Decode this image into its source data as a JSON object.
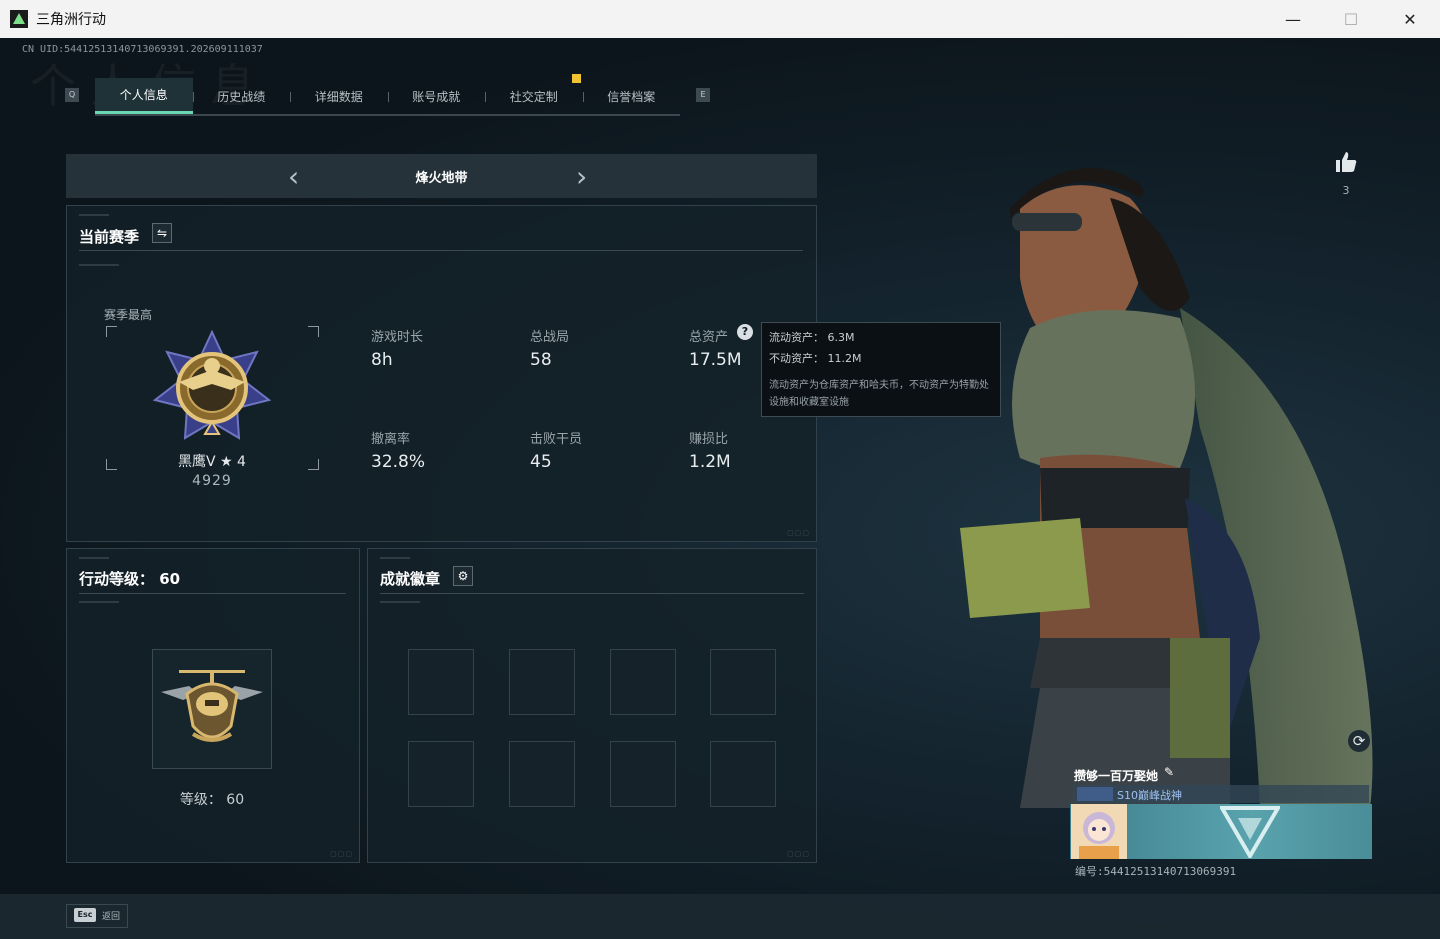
{
  "window": {
    "title": "三角洲行动",
    "min_glyph": "—",
    "max_glyph": "☐",
    "close_glyph": "✕"
  },
  "header": {
    "uid": "CN UID:5441251314071306939​1.202609111037",
    "bg_title": "个人信息",
    "tab_key_left": "Q",
    "tab_key_right": "E"
  },
  "tabs": [
    {
      "label": "个人信息",
      "active": true
    },
    {
      "label": "历史战绩",
      "active": false
    },
    {
      "label": "详细数据",
      "active": false
    },
    {
      "label": "账号成就",
      "active": false
    },
    {
      "label": "社交定制",
      "active": false
    },
    {
      "label": "信誉档案",
      "active": false
    }
  ],
  "mode": {
    "label": "烽火地带",
    "prev_glyph": "‹",
    "next_glyph": "›"
  },
  "season": {
    "title": "当前赛季",
    "switch_glyph": "⇋",
    "peak_label": "赛季最高",
    "rank_name": "黑鹰V ★ 4",
    "rank_score": "4929",
    "stats": [
      {
        "label": "游戏时长",
        "value": "8h"
      },
      {
        "label": "总战局",
        "value": "58"
      },
      {
        "label": "总资产",
        "value": "17.5M"
      },
      {
        "label": "撤离率",
        "value": "32.8%"
      },
      {
        "label": "击败干员",
        "value": "45"
      },
      {
        "label": "赚损比",
        "value": "1.2M"
      }
    ],
    "help_glyph": "?"
  },
  "tooltip": {
    "liquid": "流动资产：  6.3M",
    "fixed": "不动资产：  11.2M",
    "note": "流动资产为仓库资产和哈夫币，不动资产为特勤处设施和收藏室设施"
  },
  "level": {
    "title": "行动等级：  60",
    "caption": "等级：  60"
  },
  "badges": {
    "title": "成就徽章",
    "settings_glyph": "⚙"
  },
  "profile": {
    "like_count": "3",
    "refresh_glyph": "⟳",
    "name": "攒够一百万娶她",
    "edit_glyph": "✎",
    "title_text": "S10巅峰战神",
    "id": "编号:544125131407130693​91"
  },
  "footer": {
    "esc_key": "Esc",
    "esc_label": "返回"
  },
  "colors": {
    "accent": "#6ad7b0",
    "notify": "#f1c232",
    "panel_bg": "#142128"
  }
}
